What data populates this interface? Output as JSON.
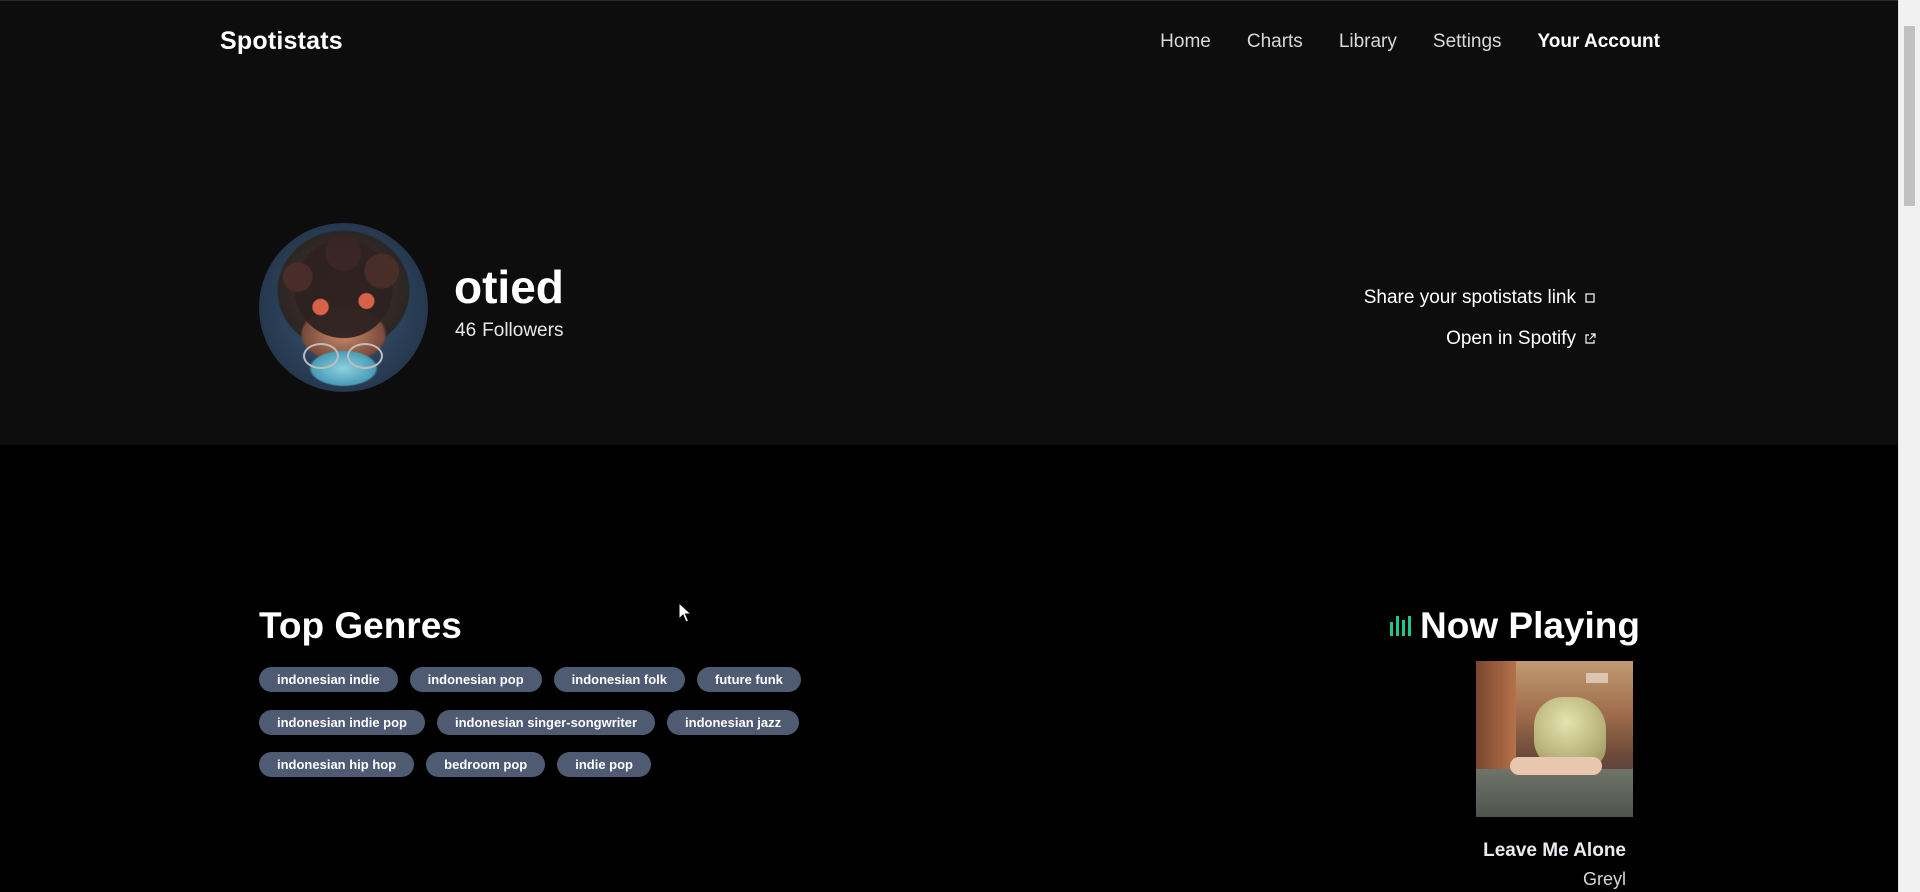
{
  "nav": {
    "brand": "Spotistats",
    "links": [
      "Home",
      "Charts",
      "Library",
      "Settings",
      "Your Account"
    ]
  },
  "profile": {
    "username": "otied",
    "followers_count": "46",
    "followers_label": "Followers",
    "share_link": "Share your spotistats link",
    "open_spotify": "Open in Spotify"
  },
  "genres": {
    "title": "Top Genres",
    "rows": [
      [
        "indonesian indie",
        "indonesian pop",
        "indonesian folk",
        "future funk"
      ],
      [
        "indonesian indie pop",
        "indonesian singer-songwriter",
        "indonesian jazz"
      ],
      [
        "indonesian hip hop",
        "bedroom pop",
        "indie pop"
      ]
    ]
  },
  "now_playing": {
    "title": "Now Playing",
    "track": "Leave Me Alone",
    "artist": "Greyl"
  },
  "colors": {
    "accent": "#1ec690",
    "tag_bg": "#4f5b72",
    "header_bg": "#0d0d0d",
    "page_bg": "#000000"
  }
}
